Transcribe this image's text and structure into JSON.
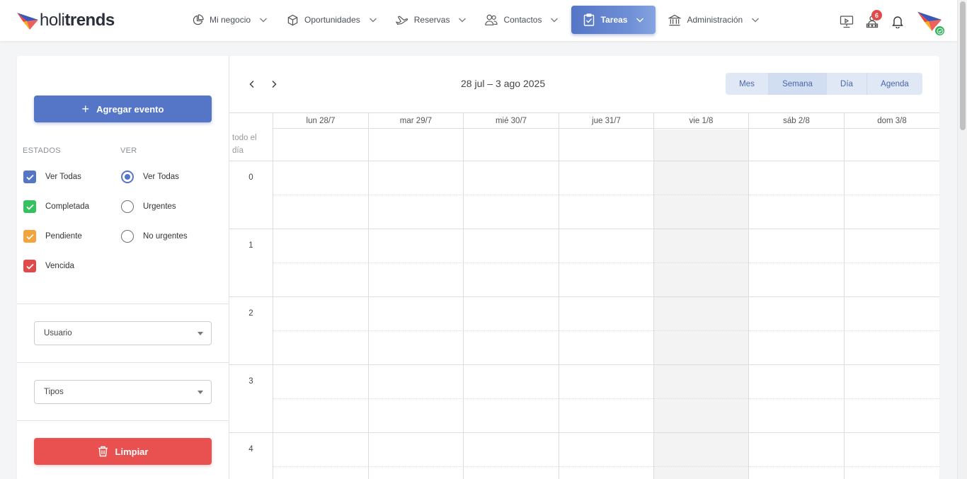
{
  "brand": {
    "name_light": "holi",
    "name_bold": "trends"
  },
  "nav": {
    "items": [
      {
        "label": "Mi negocio",
        "icon": "pie-chart-icon"
      },
      {
        "label": "Oportunidades",
        "icon": "cube-icon"
      },
      {
        "label": "Reservas",
        "icon": "plane-icon"
      },
      {
        "label": "Contactos",
        "icon": "users-icon"
      },
      {
        "label": "Tareas",
        "icon": "clipboard-check-icon",
        "active": true
      },
      {
        "label": "Administración",
        "icon": "bank-icon"
      }
    ],
    "notifications_count": "6"
  },
  "sidebar": {
    "add_event_label": "Agregar evento",
    "estados_title": "ESTADOS",
    "ver_title": "VER",
    "estados": [
      {
        "label": "Ver Todas",
        "color": "#5576c6",
        "checked": true
      },
      {
        "label": "Completada",
        "color": "#34c25f",
        "checked": true
      },
      {
        "label": "Pendiente",
        "color": "#f4a43c",
        "checked": true
      },
      {
        "label": "Vencida",
        "color": "#e24a4a",
        "checked": true
      }
    ],
    "ver": [
      {
        "label": "Ver Todas",
        "selected": true
      },
      {
        "label": "Urgentes",
        "selected": false
      },
      {
        "label": "No urgentes",
        "selected": false
      }
    ],
    "usuario_select": "Usuario",
    "tipos_select": "Tipos",
    "clear_label": "Limpiar"
  },
  "calendar": {
    "range": "28 jul – 3 ago 2025",
    "views": [
      "Mes",
      "Semana",
      "Día",
      "Agenda"
    ],
    "active_view": "Semana",
    "allday_label": "todo el día",
    "days": [
      "lun 28/7",
      "mar 29/7",
      "mié 30/7",
      "jue 31/7",
      "vie 1/8",
      "sáb 2/8",
      "dom 3/8"
    ],
    "today_index": 4,
    "hours": [
      "0",
      "1",
      "2",
      "3",
      "4"
    ]
  },
  "colors": {
    "primary": "#5576c6",
    "danger": "#e8514f",
    "success": "#2fb35b"
  }
}
